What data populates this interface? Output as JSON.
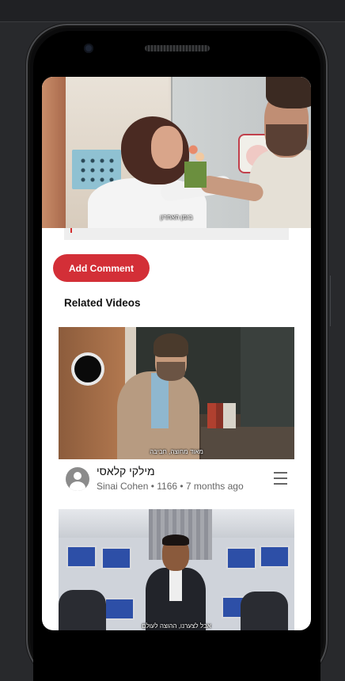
{
  "main_video": {
    "subtitle": "בזמן האחרון"
  },
  "comments": {
    "add_button_label": "Add Comment"
  },
  "related": {
    "heading": "Related Videos",
    "videos": [
      {
        "title": "מילקי קלאסי",
        "channel": "Sinai Cohen",
        "views": "1166",
        "age": "7 months ago",
        "meta": "Sinai Cohen • 1166 • 7 months ago",
        "subtitle": "מאוד מחוצה, חביבה"
      },
      {
        "subtitle": "אבל לצערנו, ההוצה לעולם"
      }
    ]
  },
  "colors": {
    "accent": "#d32f37",
    "background": "#28292c"
  },
  "icons": [
    "avatar-icon",
    "menu-icon"
  ]
}
